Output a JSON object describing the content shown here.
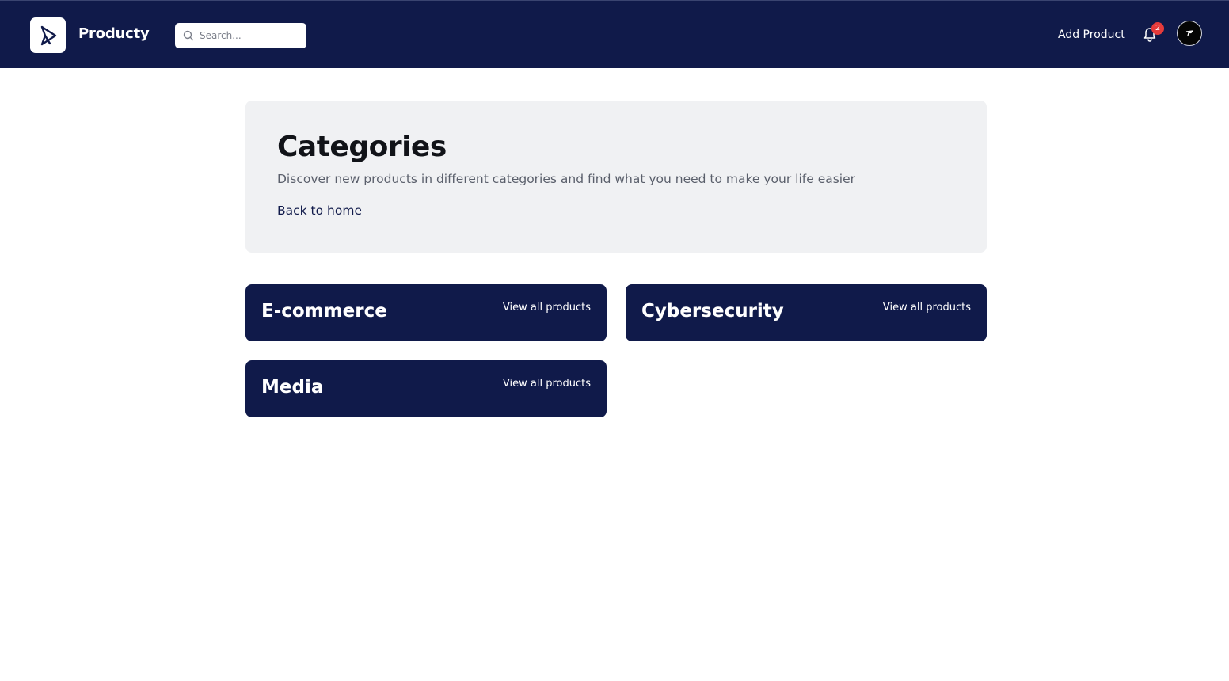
{
  "header": {
    "brand": "Producty",
    "search_placeholder": "Search...",
    "add_product_label": "Add Product",
    "notification_count": "2"
  },
  "hero": {
    "title": "Categories",
    "subtitle": "Discover new products in different categories and find what you need to make your life easier",
    "back_link": "Back to home"
  },
  "categories": [
    {
      "name": "E-commerce",
      "link": "View all products"
    },
    {
      "name": "Cybersecurity",
      "link": "View all products"
    },
    {
      "name": "Media",
      "link": "View all products"
    }
  ],
  "colors": {
    "navy": "#101a4a",
    "panel": "#f0f1f3",
    "badge": "#e53b3b"
  }
}
